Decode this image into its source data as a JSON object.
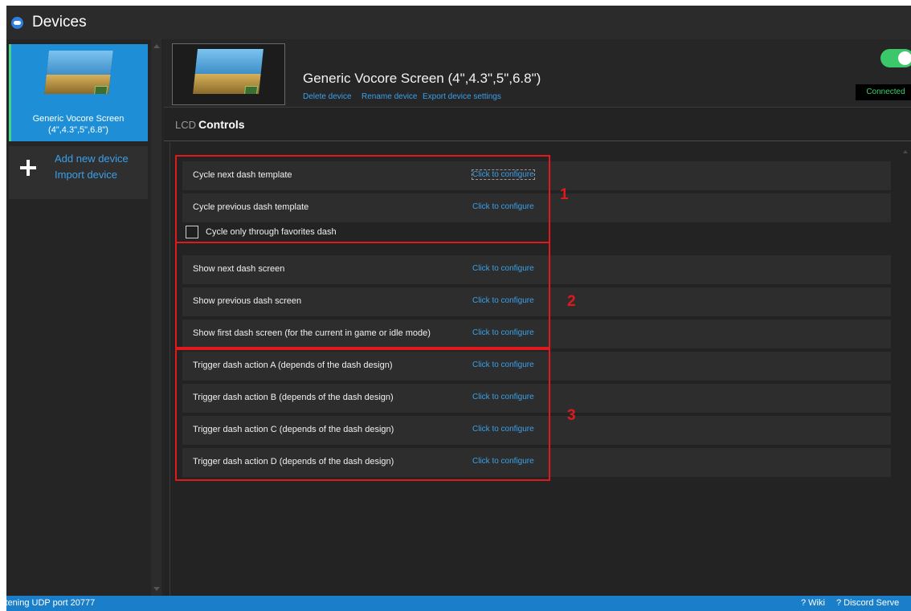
{
  "window": {
    "title": "Devices"
  },
  "sidebar": {
    "device": {
      "name": "Generic Vocore Screen (4\",4.3\",5\",6.8\")"
    },
    "add_device": "Add new device",
    "import_device": "Import device"
  },
  "header": {
    "device_name": "Generic Vocore Screen (4\",4.3\",5\",6.8\")",
    "links": {
      "delete": "Delete device",
      "rename": "Rename device",
      "export": "Export device settings"
    },
    "connection": {
      "enabled": true,
      "status": "Connected"
    }
  },
  "tabs": {
    "lcd": "LCD",
    "controls": "Controls",
    "active": "Controls"
  },
  "controls": {
    "configure_label": "Click to configure",
    "rows": [
      {
        "label": "Cycle next dash template"
      },
      {
        "label": "Cycle previous dash template"
      },
      {
        "label": "Show next dash screen"
      },
      {
        "label": "Show previous dash screen"
      },
      {
        "label": "Show first dash screen (for the current in game or idle mode)"
      },
      {
        "label": "Trigger dash action A (depends of the dash design)"
      },
      {
        "label": "Trigger dash action B (depends of the dash design)"
      },
      {
        "label": "Trigger dash action C (depends of the dash design)"
      },
      {
        "label": "Trigger dash action D (depends of the dash design)"
      }
    ],
    "checkbox": {
      "label": "Cycle only through favorites dash",
      "checked": false
    }
  },
  "annotations": {
    "group_1": "1",
    "group_2": "2",
    "group_3": "3"
  },
  "statusbar": {
    "text": "stening UDP port 20777",
    "wiki": "? Wiki",
    "discord": "? Discord Serve"
  },
  "colors": {
    "accent": "#1e8fd6",
    "link": "#3aa0ea",
    "connected": "#37d36a",
    "annotation": "#e0191f",
    "statusbar": "#1a7fc8"
  }
}
